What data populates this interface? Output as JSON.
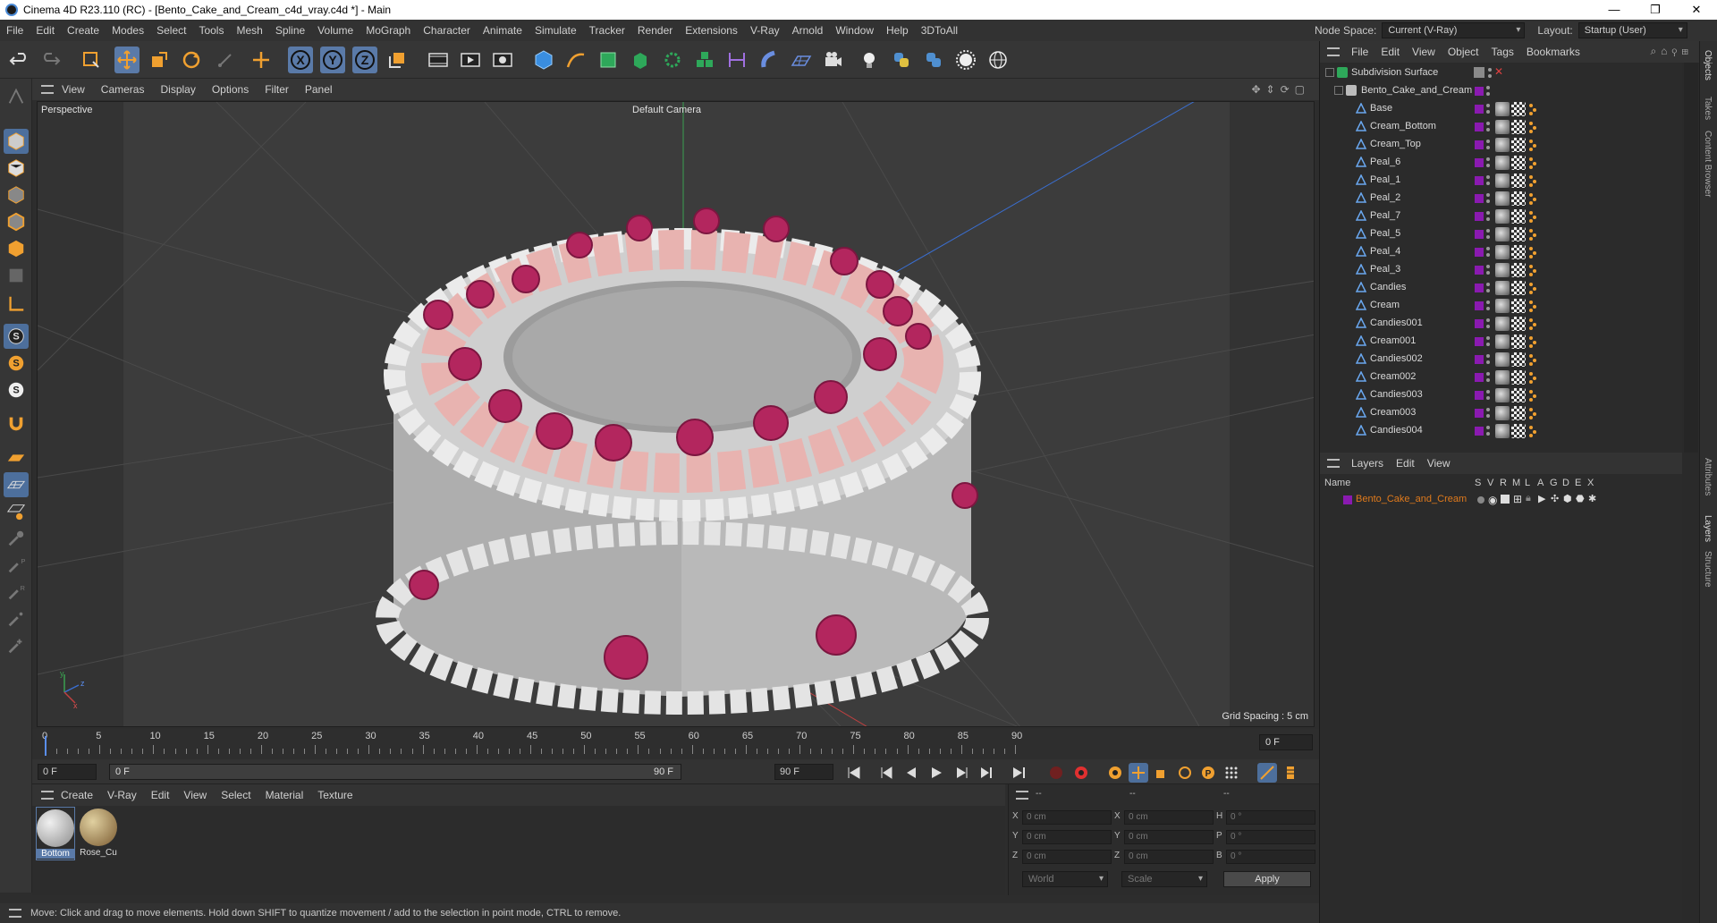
{
  "window": {
    "title": "Cinema 4D R23.110 (RC) - [Bento_Cake_and_Cream_c4d_vray.c4d *] - Main",
    "controls": [
      "—",
      "❐",
      "✕"
    ]
  },
  "menubar": {
    "items": [
      "File",
      "Edit",
      "Create",
      "Modes",
      "Select",
      "Tools",
      "Mesh",
      "Spline",
      "Volume",
      "MoGraph",
      "Character",
      "Animate",
      "Simulate",
      "Tracker",
      "Render",
      "Extensions",
      "V-Ray",
      "Arnold",
      "Window",
      "Help",
      "3DToAll"
    ],
    "node_space_label": "Node Space:",
    "node_space_value": "Current (V-Ray)",
    "layout_label": "Layout:",
    "layout_value": "Startup (User)"
  },
  "viewport": {
    "menu": [
      "View",
      "Cameras",
      "Display",
      "Options",
      "Filter",
      "Panel"
    ],
    "view_name": "Perspective",
    "camera": "Default Camera",
    "grid_spacing": "Grid Spacing : 5 cm",
    "axis_labels": {
      "y": "y",
      "z": "z",
      "x": "x"
    }
  },
  "timeline": {
    "ticks": [
      "0",
      "5",
      "10",
      "15",
      "20",
      "25",
      "30",
      "35",
      "40",
      "45",
      "50",
      "55",
      "60",
      "65",
      "70",
      "75",
      "80",
      "85",
      "90"
    ],
    "current_frame": "0 F",
    "start_field": "0 F",
    "range_start": "0 F",
    "range_end": "90 F",
    "end_field": "90 F"
  },
  "materials": {
    "menu": [
      "Create",
      "V-Ray",
      "Edit",
      "View",
      "Select",
      "Material",
      "Texture"
    ],
    "items": [
      {
        "name": "Bottom",
        "color": "#b8b8b8"
      },
      {
        "name": "Rose_Cu",
        "color": "#a08060"
      }
    ]
  },
  "coordinates": {
    "header": [
      "--",
      "--",
      "--"
    ],
    "rows": [
      {
        "l1": "X",
        "v1": "0 cm",
        "l2": "X",
        "v2": "0 cm",
        "l3": "H",
        "v3": "0 °"
      },
      {
        "l1": "Y",
        "v1": "0 cm",
        "l2": "Y",
        "v2": "0 cm",
        "l3": "P",
        "v3": "0 °"
      },
      {
        "l1": "Z",
        "v1": "0 cm",
        "l2": "Z",
        "v2": "0 cm",
        "l3": "B",
        "v3": "0 °"
      }
    ],
    "space": "World",
    "mode": "Scale",
    "apply": "Apply"
  },
  "status": {
    "text": "Move: Click and drag to move elements. Hold down SHIFT to quantize movement / add to the selection in point mode, CTRL to remove."
  },
  "objects": {
    "menu": [
      "File",
      "Edit",
      "View",
      "Object",
      "Tags",
      "Bookmarks"
    ],
    "root": "Subdivision Surface",
    "group": "Bento_Cake_and_Cream",
    "items": [
      "Base",
      "Cream_Bottom",
      "Cream_Top",
      "Peal_6",
      "Peal_1",
      "Peal_2",
      "Peal_7",
      "Peal_5",
      "Peal_4",
      "Peal_3",
      "Candies",
      "Cream",
      "Candies001",
      "Cream001",
      "Candies002",
      "Cream002",
      "Candies003",
      "Cream003",
      "Candies004"
    ],
    "swatch_color": "#8a1ab0"
  },
  "layers": {
    "menu": [
      "Layers",
      "Edit",
      "View"
    ],
    "columns": [
      "Name",
      "S",
      "V",
      "R",
      "M",
      "L",
      "A",
      "G",
      "D",
      "E",
      "X"
    ],
    "items": [
      {
        "name": "Bento_Cake_and_Cream",
        "color": "#8a1ab0"
      }
    ]
  },
  "side_tabs": [
    "Objects",
    "Takes",
    "Content Browser",
    "Attributes",
    "Layers",
    "Structure"
  ],
  "colors": {
    "accent": "#5a7aa8",
    "layer_text": "#e07a1c"
  }
}
